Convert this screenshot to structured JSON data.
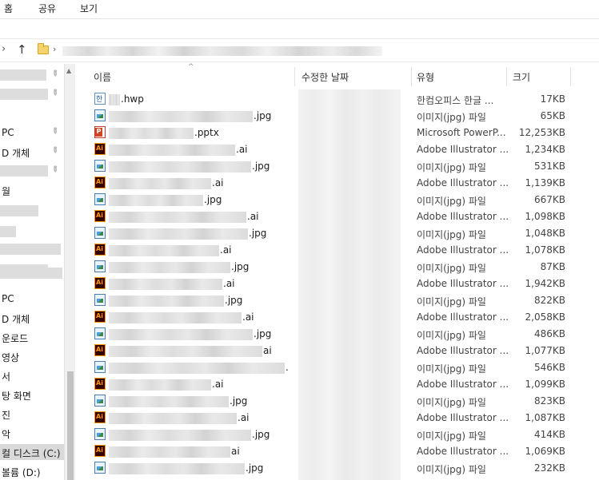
{
  "ribbon": {
    "tabs": [
      "홈",
      "공유",
      "보기"
    ]
  },
  "nav": {
    "items": [
      {
        "label": "",
        "pinned": true
      },
      {
        "label": "",
        "pinned": true
      },
      {
        "label": "PC",
        "pinned": true
      },
      {
        "label": "D 개체",
        "pinned": true
      },
      {
        "label": "",
        "pinned": true
      },
      {
        "label": "월",
        "pinned": false
      },
      {
        "label": "",
        "pinned": false
      },
      {
        "label": "",
        "pinned": false
      },
      {
        "label": "",
        "pinned": false
      },
      {
        "label": "",
        "pinned": false
      },
      {
        "label": "",
        "pinned": false
      },
      {
        "label": "PC",
        "pinned": false
      },
      {
        "label": "D 개체",
        "pinned": false
      },
      {
        "label": "운로드",
        "pinned": false
      },
      {
        "label": "영상",
        "pinned": false
      },
      {
        "label": "서",
        "pinned": false
      },
      {
        "label": "탕 화면",
        "pinned": false
      },
      {
        "label": "진",
        "pinned": false
      },
      {
        "label": "악",
        "pinned": false
      },
      {
        "label": "컬 디스크 (C:)",
        "pinned": false,
        "selected": true
      },
      {
        "label": "볼륨 (D:)",
        "pinned": false
      }
    ]
  },
  "columns": {
    "name": "이름",
    "date": "수정한 날짜",
    "type": "유형",
    "size": "크기"
  },
  "files": [
    {
      "icon": "hwp-icon",
      "ext": ".hwp",
      "type": "한컴오피스 한글 ...",
      "size": "17KB"
    },
    {
      "icon": "image-icon",
      "ext": ".jpg",
      "type": "이미지(jpg) 파일",
      "size": "65KB"
    },
    {
      "icon": "ppt-icon",
      "ext": ".pptx",
      "type": "Microsoft PowerP...",
      "size": "12,253KB"
    },
    {
      "icon": "ai-icon",
      "ext": ".ai",
      "type": "Adobe Illustrator ...",
      "size": "1,234KB"
    },
    {
      "icon": "image-icon",
      "ext": ".jpg",
      "type": "이미지(jpg) 파일",
      "size": "531KB"
    },
    {
      "icon": "ai-icon",
      "ext": ".ai",
      "type": "Adobe Illustrator ...",
      "size": "1,139KB"
    },
    {
      "icon": "image-icon",
      "ext": ".jpg",
      "type": "이미지(jpg) 파일",
      "size": "667KB"
    },
    {
      "icon": "ai-icon",
      "ext": ".ai",
      "type": "Adobe Illustrator ...",
      "size": "1,098KB"
    },
    {
      "icon": "image-icon",
      "ext": ".jpg",
      "type": "이미지(jpg) 파일",
      "size": "1,048KB"
    },
    {
      "icon": "ai-icon",
      "ext": ".ai",
      "type": "Adobe Illustrator ...",
      "size": "1,078KB"
    },
    {
      "icon": "image-icon",
      "ext": ".jpg",
      "type": "이미지(jpg) 파일",
      "size": "87KB"
    },
    {
      "icon": "ai-icon",
      "ext": ".ai",
      "type": "Adobe Illustrator ...",
      "size": "1,942KB"
    },
    {
      "icon": "image-icon",
      "ext": ".jpg",
      "type": "이미지(jpg) 파일",
      "size": "822KB"
    },
    {
      "icon": "ai-icon",
      "ext": ".ai",
      "type": "Adobe Illustrator ...",
      "size": "2,058KB"
    },
    {
      "icon": "image-icon",
      "ext": ".jpg",
      "type": "이미지(jpg) 파일",
      "size": "486KB"
    },
    {
      "icon": "ai-icon",
      "ext": "ai",
      "type": "Adobe Illustrator ...",
      "size": "1,077KB"
    },
    {
      "icon": "image-icon",
      "ext": ".",
      "type": "이미지(jpg) 파일",
      "size": "546KB"
    },
    {
      "icon": "ai-icon",
      "ext": ".ai",
      "type": "Adobe Illustrator ...",
      "size": "1,099KB"
    },
    {
      "icon": "image-icon",
      "ext": ".jpg",
      "type": "이미지(jpg) 파일",
      "size": "823KB"
    },
    {
      "icon": "ai-icon",
      "ext": ".ai",
      "type": "Adobe Illustrator ...",
      "size": "1,087KB"
    },
    {
      "icon": "image-icon",
      "ext": ".jpg",
      "type": "이미지(jpg) 파일",
      "size": "414KB"
    },
    {
      "icon": "ai-icon",
      "ext": "ai",
      "type": "Adobe Illustrator ...",
      "size": "1,069KB"
    },
    {
      "icon": "image-icon",
      "ext": ".jpg",
      "type": "이미지(jpg) 파일",
      "size": "232KB"
    }
  ]
}
